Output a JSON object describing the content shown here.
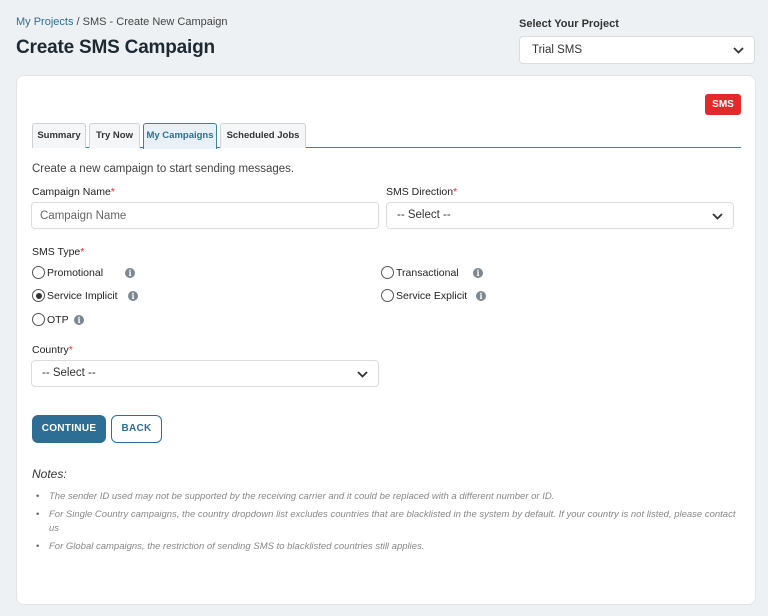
{
  "breadcrumb": {
    "root": "My Projects",
    "sep": " / ",
    "current": "SMS - Create New Campaign"
  },
  "page_title": "Create SMS Campaign",
  "project_select": {
    "label": "Select Your Project",
    "value": "Trial SMS"
  },
  "badge": "SMS",
  "tabs": [
    {
      "label": "Summary",
      "active": false
    },
    {
      "label": "Try Now",
      "active": false
    },
    {
      "label": "My Campaigns",
      "active": true
    },
    {
      "label": "Scheduled Jobs",
      "active": false
    }
  ],
  "intro": "Create a new campaign to start sending messages.",
  "form": {
    "campaign_name": {
      "label": "Campaign Name",
      "required": "*",
      "placeholder": "Campaign Name"
    },
    "sms_direction": {
      "label": "SMS Direction",
      "required": "*",
      "value": "-- Select --"
    },
    "sms_type": {
      "label": "SMS Type",
      "required": "*",
      "options": [
        {
          "label": "Promotional",
          "selected": false
        },
        {
          "label": "Transactional",
          "selected": false
        },
        {
          "label": "Service Implicit",
          "selected": true
        },
        {
          "label": "Service Explicit",
          "selected": false
        },
        {
          "label": "OTP",
          "selected": false
        }
      ]
    },
    "country": {
      "label": "Country",
      "required": "*",
      "value": "-- Select --"
    }
  },
  "buttons": {
    "continue": "CONTINUE",
    "back": "BACK"
  },
  "notes": {
    "title": "Notes:",
    "items": [
      "The sender ID used may not be supported by the receiving carrier and it could be replaced with a different number or ID.",
      "For Single Country campaigns, the country dropdown list excludes countries that are blacklisted in the system by default. If your country is not listed, please contact us",
      "For Global campaigns, the restriction of sending SMS to blacklisted countries still applies."
    ]
  },
  "icons": {
    "info": "info-icon",
    "chevron": "chevron-down-icon"
  },
  "colors": {
    "primary": "#2f6e94",
    "badge": "#e32929",
    "required": "#e32929"
  }
}
